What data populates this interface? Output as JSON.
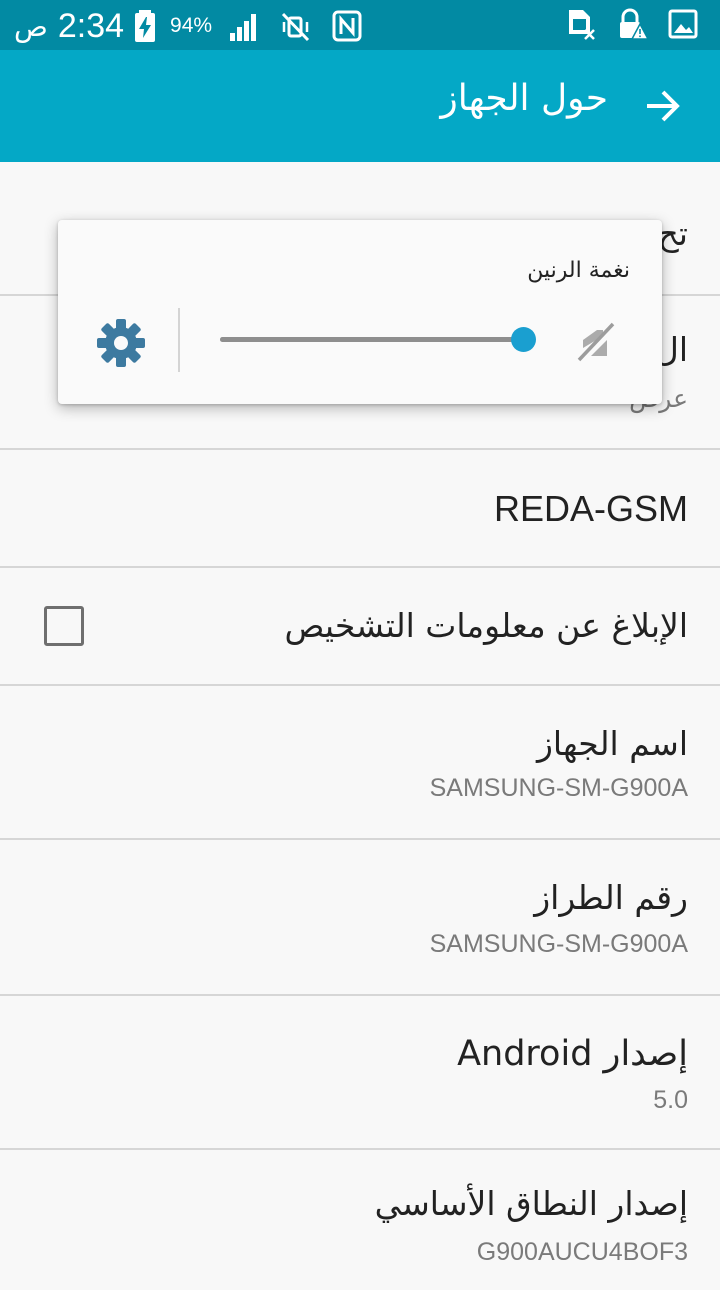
{
  "status_bar": {
    "ampm": "ص",
    "time": "2:34",
    "battery": "94%",
    "icons": [
      "battery-charging-icon",
      "signal-icon",
      "vibrate-off-icon",
      "nfc-icon",
      "no-sim-icon",
      "lock-warning-icon",
      "image-icon"
    ]
  },
  "app_bar": {
    "title": "حول الجهاز",
    "back_icon": "arrow-right-icon"
  },
  "rows": [
    {
      "title": "تح",
      "subtitle": ""
    },
    {
      "title": "ال",
      "subtitle": "عرض"
    },
    {
      "title": "REDA-GSM",
      "subtitle": ""
    },
    {
      "title": "الإبلاغ عن معلومات التشخيص",
      "checked": false
    },
    {
      "title": "اسم الجهاز",
      "subtitle": "SAMSUNG-SM-G900A"
    },
    {
      "title": "رقم الطراز",
      "subtitle": "SAMSUNG-SM-G900A"
    },
    {
      "title": "إصدار Android",
      "subtitle": "5.0"
    },
    {
      "title": "إصدار النطاق الأساسي",
      "subtitle": "G900AUCU4BOF3"
    }
  ],
  "volume_popup": {
    "title": "نغمة الرنين",
    "level": 0.99,
    "settings_icon": "gear-icon",
    "mute_icon": "ringer-muted-icon"
  },
  "colors": {
    "status_bar": "#028aa3",
    "app_bar": "#04a8c6",
    "accent": "#1a9fd0",
    "gear": "#3d7aa0"
  }
}
